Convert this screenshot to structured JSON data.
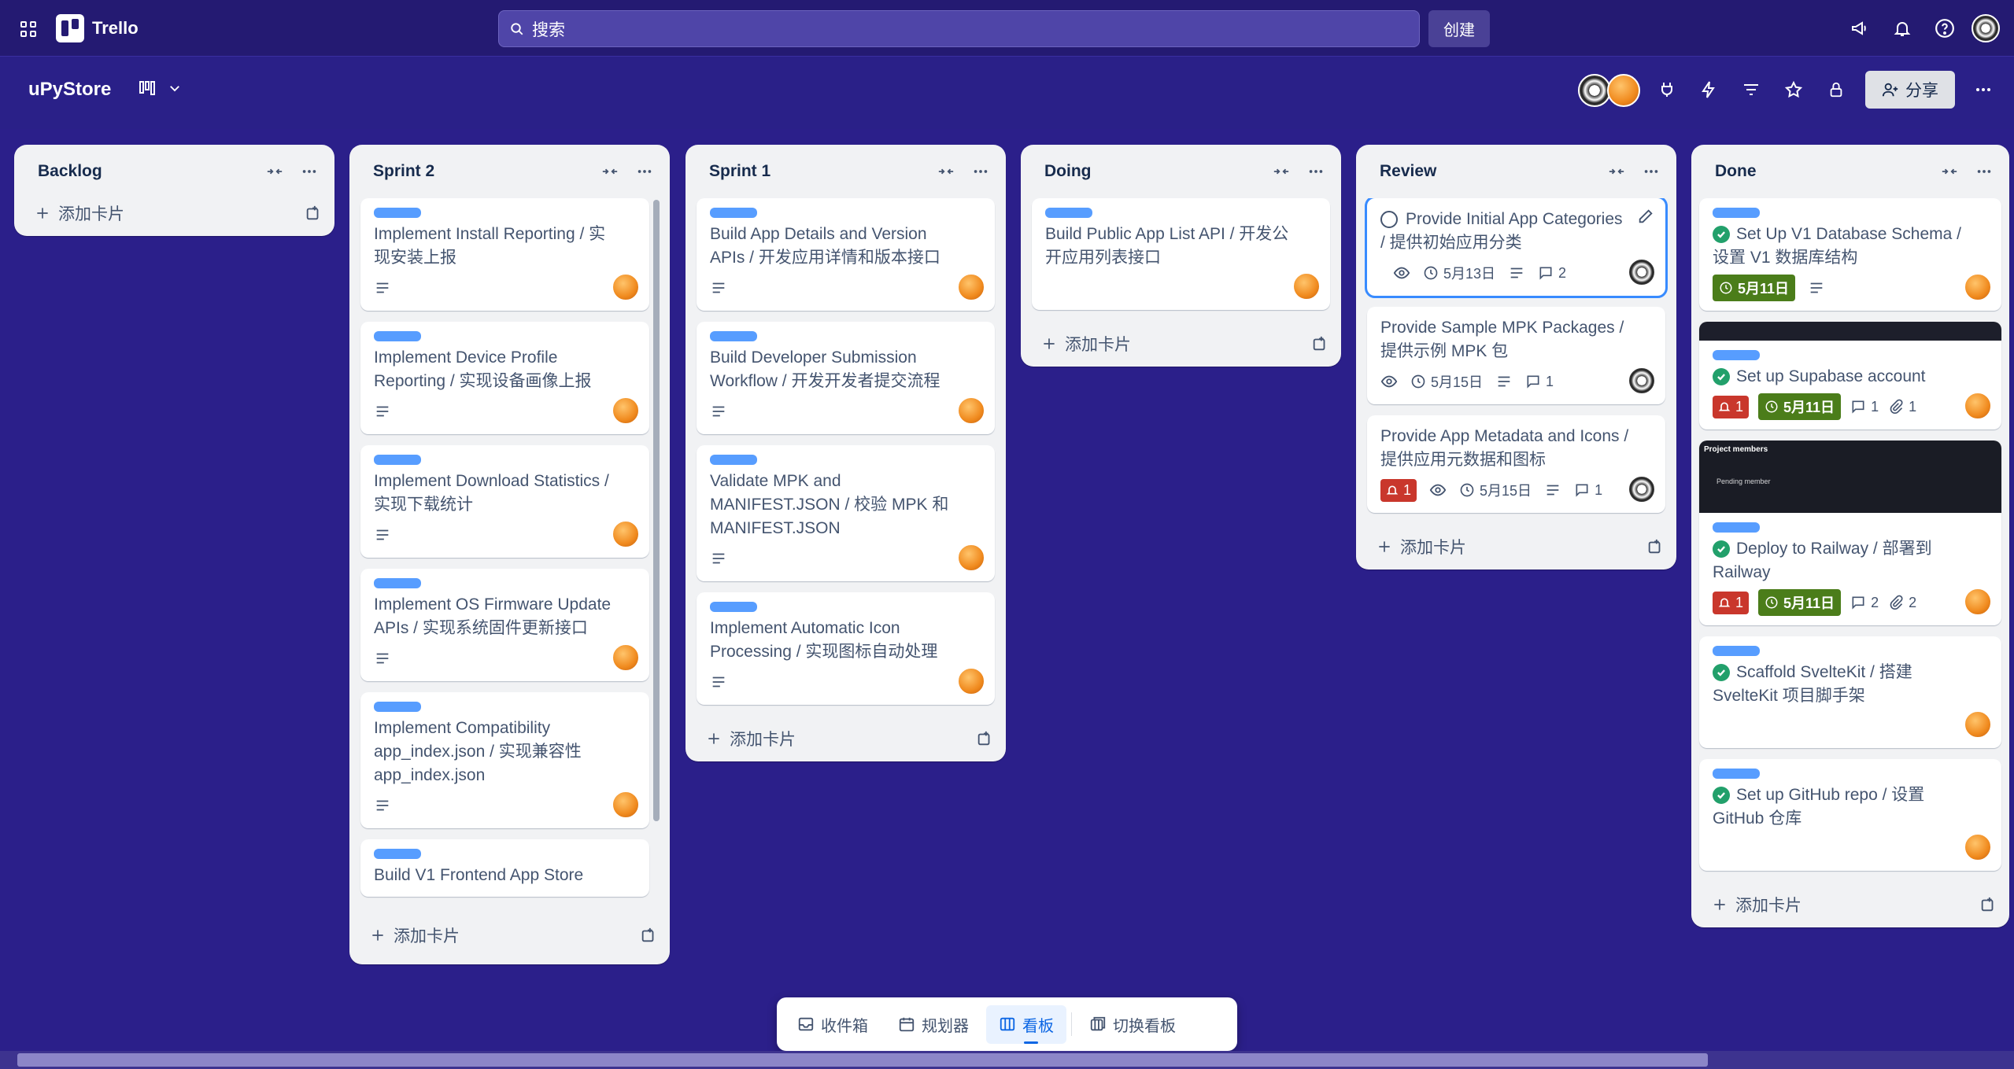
{
  "app": {
    "name": "Trello"
  },
  "search": {
    "placeholder": "搜索"
  },
  "topbar": {
    "create_label": "创建"
  },
  "board": {
    "title": "uPyStore",
    "share_label": "分享"
  },
  "add_card_label": "添加卡片",
  "lists": [
    {
      "name": "Backlog",
      "cards": []
    },
    {
      "name": "Sprint 2",
      "cards": [
        {
          "title": "Implement Install Reporting / 实现安装上报"
        },
        {
          "title": "Implement Device Profile Reporting / 实现设备画像上报"
        },
        {
          "title": "Implement Download Statistics / 实现下载统计"
        },
        {
          "title": "Implement OS Firmware Update APIs / 实现系统固件更新接口"
        },
        {
          "title": "Implement Compatibility app_index.json / 实现兼容性 app_index.json"
        },
        {
          "title": "Build V1 Frontend App Store"
        }
      ]
    },
    {
      "name": "Sprint 1",
      "cards": [
        {
          "title": "Build App Details and Version APIs / 开发应用详情和版本接口"
        },
        {
          "title": "Build Developer Submission Workflow / 开发开发者提交流程"
        },
        {
          "title": "Validate MPK and MANIFEST.JSON / 校验 MPK 和 MANIFEST.JSON"
        },
        {
          "title": "Implement Automatic Icon Processing / 实现图标自动处理"
        }
      ]
    },
    {
      "name": "Doing",
      "cards": [
        {
          "title": "Build Public App List API / 开发公开应用列表接口"
        }
      ]
    },
    {
      "name": "Review",
      "cards": [
        {
          "title": "Provide Initial App Categories / 提供初始应用分类",
          "due": "5月13日",
          "comments": "2"
        },
        {
          "title": "Provide Sample MPK Packages / 提供示例 MPK 包",
          "due": "5月15日",
          "comments": "1"
        },
        {
          "title": "Provide App Metadata and Icons / 提供应用元数据和图标",
          "alerts": "1",
          "due": "5月15日",
          "comments": "1"
        }
      ]
    },
    {
      "name": "Done",
      "cards": [
        {
          "title": "Set Up V1 Database Schema / 设置 V1 数据库结构",
          "due": "5月11日"
        },
        {
          "title": "Set up Supabase account",
          "alerts": "1",
          "due": "5月11日",
          "comments": "1",
          "attachments": "1"
        },
        {
          "title": "Deploy to Railway / 部署到 Railway",
          "alerts": "1",
          "due": "5月11日",
          "comments": "2",
          "attachments": "2",
          "cover_text": "Project members",
          "cover_sub": "Pending member"
        },
        {
          "title": "Scaffold SvelteKit / 搭建 SvelteKit 项目脚手架"
        },
        {
          "title": "Set up GitHub repo / 设置 GitHub 仓库"
        }
      ]
    }
  ],
  "dock": {
    "inbox": "收件箱",
    "planner": "规划器",
    "board": "看板",
    "switch": "切换看板"
  },
  "colors": {
    "background": "#2b1f8a",
    "label": "#579dff",
    "due_complete": "#4b7d1a",
    "alert": "#c9372c"
  }
}
